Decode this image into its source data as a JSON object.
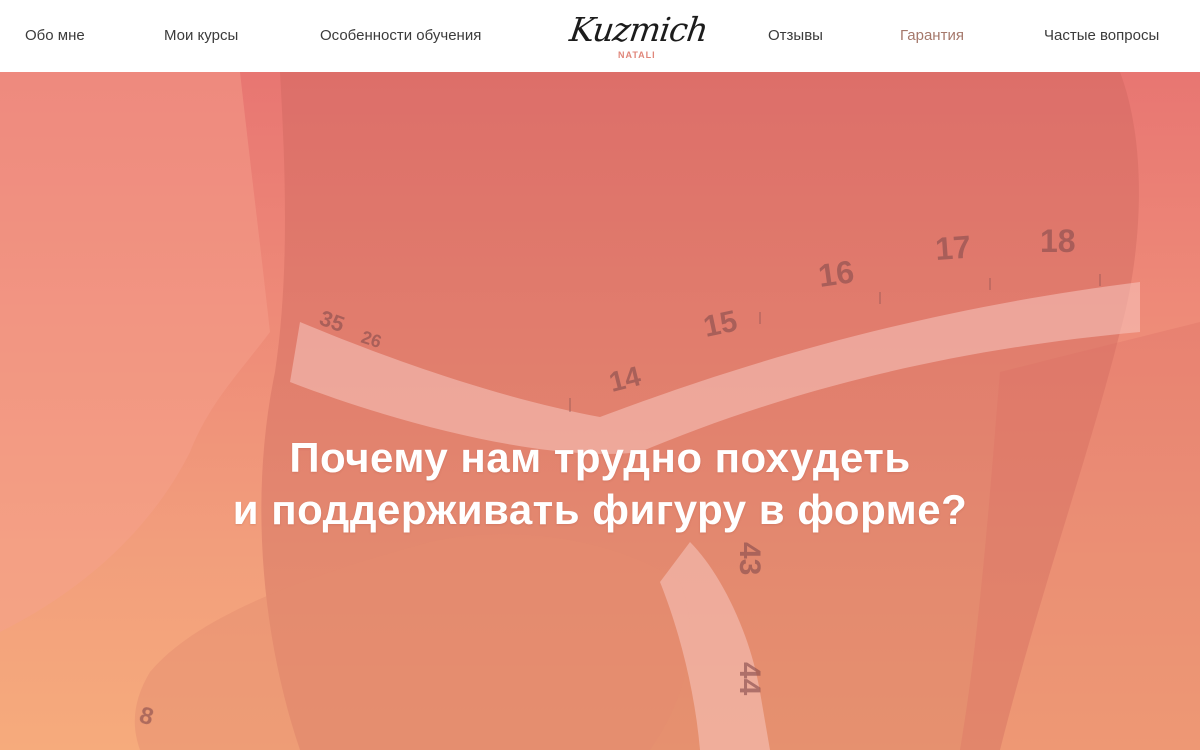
{
  "nav": {
    "left": [
      {
        "label": "Обо мне"
      },
      {
        "label": "Мои курсы"
      },
      {
        "label": "Особенности обучения"
      }
    ],
    "right": [
      {
        "label": "Отзывы"
      },
      {
        "label": "Гарантия",
        "active": true
      },
      {
        "label": "Частые вопросы"
      }
    ]
  },
  "logo": {
    "script": "Kuzmich",
    "sub": "NATALI"
  },
  "hero": {
    "title_line1": "Почему нам трудно похудеть",
    "title_line2": "и поддерживать фигуру в форме?",
    "tape_numbers_top": [
      "35",
      "26",
      "14",
      "15",
      "16",
      "17",
      "18"
    ],
    "tape_numbers_bottom": [
      "43",
      "44"
    ],
    "tape_number_edge": "8"
  },
  "colors": {
    "nav_text": "#3b3b3b",
    "nav_active": "#a5786b",
    "hero_top": "#e87672",
    "hero_bottom": "#f6ab7c",
    "logo_accent": "#e0867a"
  }
}
